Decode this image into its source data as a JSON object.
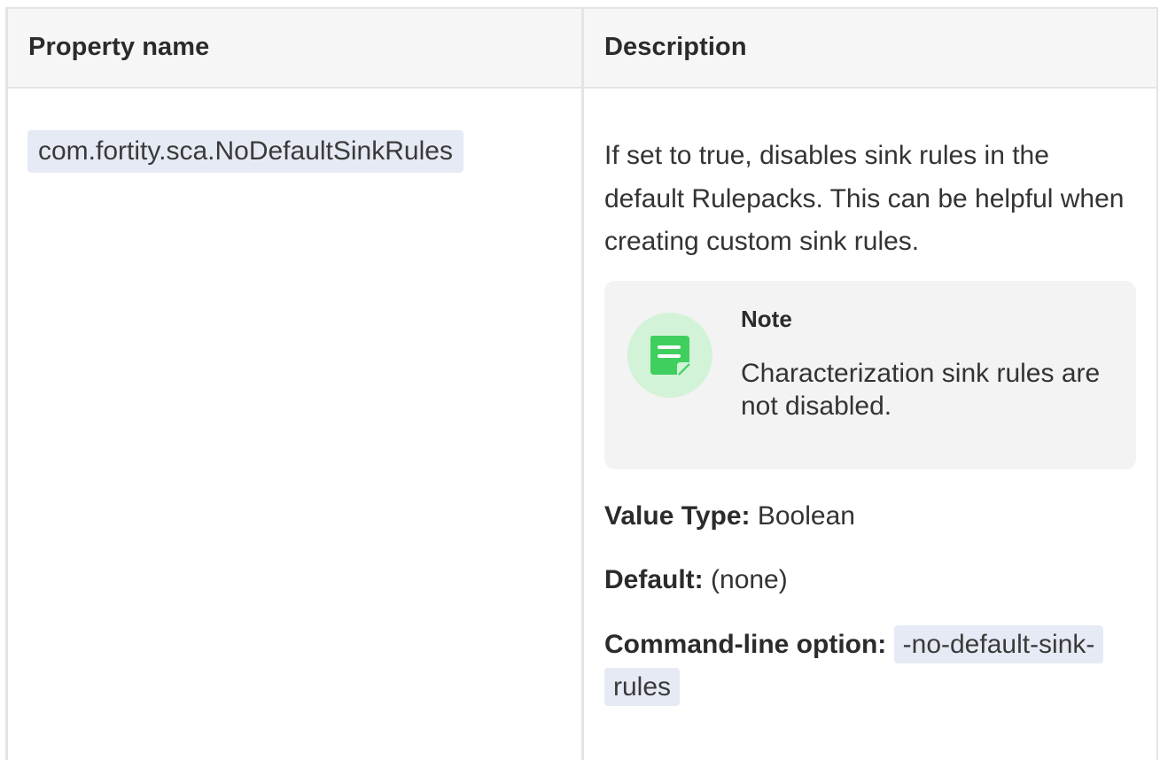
{
  "table": {
    "headers": {
      "property_name": "Property name",
      "description": "Description"
    },
    "rows": [
      {
        "property": "com.fortity.sca.NoDefaultSinkRules",
        "description": "If set to true, disables sink rules in the default Rulepacks. This can be helpful when creating custom sink rules.",
        "note": {
          "title": "Note",
          "body": "Characterization sink rules are not disabled.",
          "icon": "note-icon"
        },
        "value_type_label": "Value Type:",
        "value_type": "Boolean",
        "default_label": "Default:",
        "default": "(none)",
        "cli_label": "Command-line option:",
        "cli_option": "-no-default-sink-rules"
      }
    ]
  },
  "colors": {
    "code_background": "#e6eaf4",
    "note_background": "#f3f3f3",
    "note_icon_circle": "#d2f3d7",
    "note_icon": "#3fcf5e",
    "header_background": "#f6f6f6",
    "border": "#e4e4e4"
  }
}
